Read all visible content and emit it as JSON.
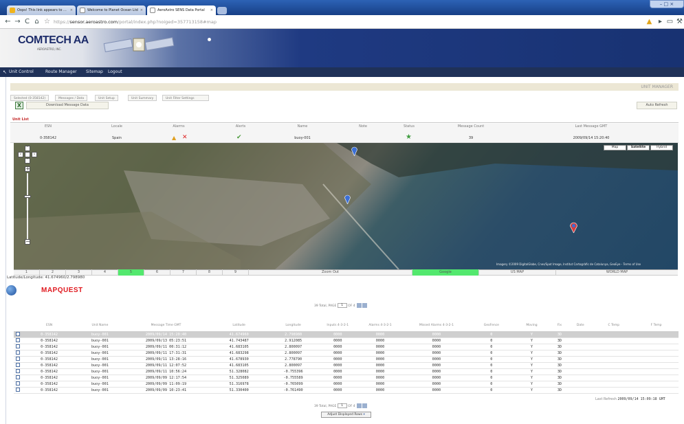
{
  "browser": {
    "tabs": [
      {
        "label": "Oops! This link appears to ...",
        "icon": "warning-page-icon"
      },
      {
        "label": "Welcome to Planet Ocean Ltd",
        "icon": "page-icon"
      },
      {
        "label": "AeroAstro SENS Data Portal",
        "icon": "page-icon"
      }
    ],
    "url_host": "sensor.aeroastro.com",
    "url_scheme": "https://",
    "url_rest": "/portal/index.php?noiged=357713158#map"
  },
  "brand": {
    "logo_text": "COMTECH AA",
    "logo_sub": "AEROASTRO, INC."
  },
  "menu": {
    "items": [
      "Unit Control",
      "Route Manager",
      "Sitemap",
      "Logout"
    ]
  },
  "manager": {
    "title": "UNIT MANAGER"
  },
  "subtabs": {
    "selected": "Selected (0-358142)",
    "items": [
      "Messages / Data",
      "Unit Setup",
      "Unit Summary",
      "Unit Filter Settings"
    ]
  },
  "actions": {
    "download": "Download Message Data",
    "auto_refresh": "Auto Refresh"
  },
  "unit_list": {
    "label": "Unit List",
    "headers": [
      "ESN",
      "Locale",
      "Alarms",
      "Alerts",
      "Name",
      "Note",
      "Status",
      "Message Count",
      "Last Message GMT"
    ],
    "row": {
      "esn": "0-358142",
      "locale": "Spain",
      "name": "buoy-001",
      "note": "",
      "message_count": "39",
      "last_message": "2009/09/14 15:20:40"
    }
  },
  "map": {
    "modes": [
      "Map",
      "Satellite",
      "Hybrid"
    ],
    "attribution": "Imagery ©2009 DigitalGlobe, Cnes/Spot Image, Institut Cartogràfic de Catalunya, GeoEye - Terms of Use",
    "pages": [
      "1",
      "2",
      "3",
      "4",
      "5",
      "6",
      "7",
      "8",
      "9"
    ],
    "active_page": "5",
    "zoom_out": "Zoom Out",
    "providers": [
      "Google",
      "US MAP",
      "WORLD MAP"
    ],
    "active_provider": "Google",
    "latlon": "Latitude/Longitude: 41.674960/2.798980"
  },
  "mapquest": {
    "logo": "MAPQUEST"
  },
  "pager": {
    "text": "39 Total, PAGE",
    "page": "1",
    "of": "OF 4"
  },
  "data_table": {
    "headers": [
      "",
      "ESN",
      "Unit Name",
      "Message Time GMT",
      "Latitude",
      "Longitude",
      "Inputs 4-3-2-1",
      "Alarms 4-3-2-1",
      "Missed Alarms 4-3-2-1",
      "GeoFence",
      "Moving",
      "Fix",
      "Date",
      "C Temp",
      "F Temp"
    ],
    "rows": [
      [
        "0-358142",
        "buoy-001",
        "2009/09/14 15:20:40",
        "41.674960",
        "2.798980",
        "0000",
        "0000",
        "0000",
        "0",
        "Y",
        "3D",
        "",
        "",
        ""
      ],
      [
        "0-358142",
        "buoy-001",
        "2009/09/13 05:23:51",
        "41.743487",
        "2.912085",
        "0000",
        "0000",
        "0000",
        "0",
        "Y",
        "3D",
        "",
        "",
        ""
      ],
      [
        "0-358142",
        "buoy-001",
        "2009/09/11 00:31:12",
        "41.683105",
        "2.800097",
        "0000",
        "0000",
        "0000",
        "0",
        "Y",
        "3D",
        "",
        "",
        ""
      ],
      [
        "0-358142",
        "buoy-001",
        "2009/09/11 17:31:31",
        "41.683298",
        "2.800097",
        "0000",
        "0000",
        "0000",
        "0",
        "Y",
        "3D",
        "",
        "",
        ""
      ],
      [
        "0-358142",
        "buoy-001",
        "2009/09/11 13:28:16",
        "41.678930",
        "2.778790",
        "0000",
        "0000",
        "0000",
        "0",
        "Y",
        "3D",
        "",
        "",
        ""
      ],
      [
        "0-358142",
        "buoy-001",
        "2009/09/11 12:07:52",
        "41.683105",
        "2.800097",
        "0000",
        "0000",
        "0000",
        "0",
        "Y",
        "3D",
        "",
        "",
        ""
      ],
      [
        "0-358142",
        "buoy-001",
        "2009/09/11 10:56:24",
        "51.328082",
        "-0.755396",
        "0000",
        "0000",
        "0000",
        "0",
        "Y",
        "3D",
        "",
        "",
        ""
      ],
      [
        "0-358142",
        "buoy-001",
        "2009/09/09 12:17:54",
        "51.325089",
        "-0.755589",
        "0000",
        "0000",
        "0000",
        "0",
        "Y",
        "3D",
        "",
        "",
        ""
      ],
      [
        "0-358142",
        "buoy-001",
        "2009/09/09 11:09:19",
        "51.316978",
        "-0.765099",
        "0000",
        "0000",
        "0000",
        "0",
        "Y",
        "3D",
        "",
        "",
        ""
      ],
      [
        "0-358142",
        "buoy-001",
        "2009/09/09 10:23:41",
        "51.330400",
        "-0.761490",
        "0000",
        "0000",
        "0000",
        "0",
        "Y",
        "3D",
        "",
        "",
        ""
      ]
    ]
  },
  "last_refresh": {
    "label": "Last Refresh",
    "value": "2009/09/14 15:09:18 GMT"
  },
  "adjust_rows": "Adjust Displayed Rows",
  "colors": {
    "accent_red": "#c42828",
    "nav_dark": "#1f3158",
    "selected_page": "#53e86e",
    "banner_blue": "#1f3a82"
  }
}
